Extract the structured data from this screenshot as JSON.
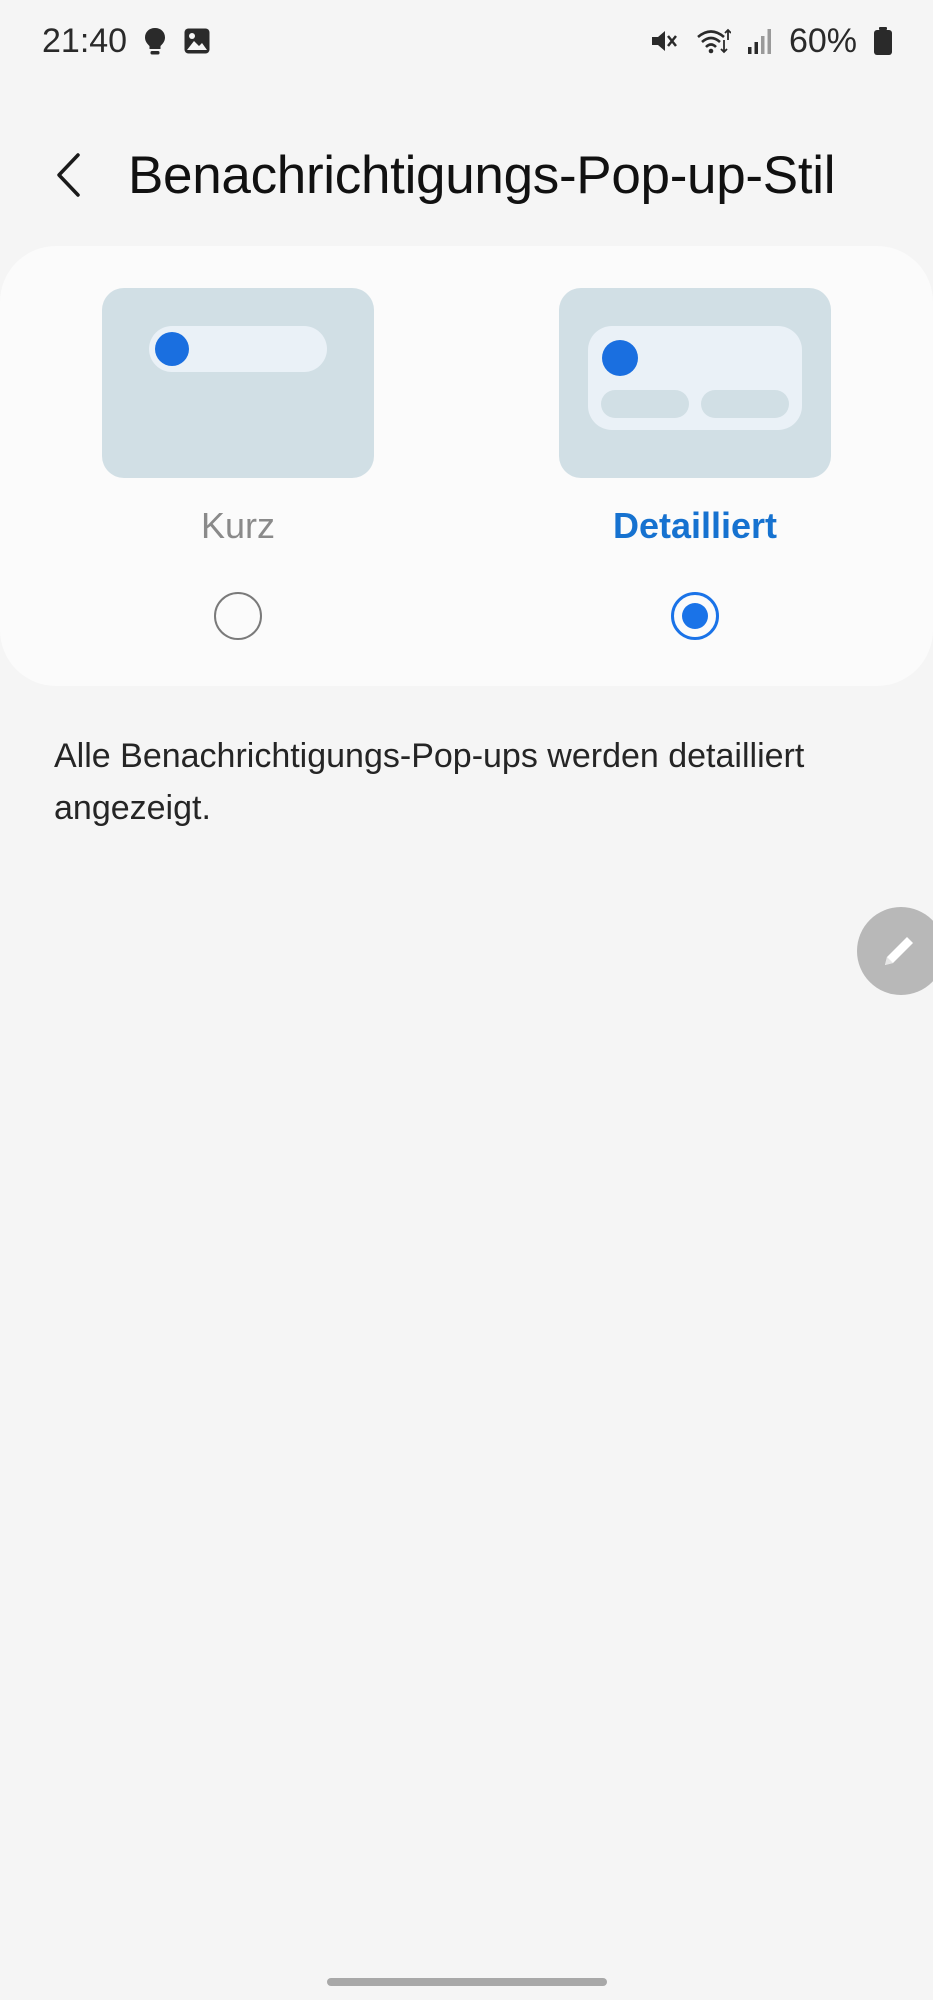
{
  "status_bar": {
    "time": "21:40",
    "battery": "60%",
    "icons": [
      "bulb-icon",
      "image-icon",
      "vibrate-mute-icon",
      "wifi-icon",
      "signal-icon",
      "battery-icon"
    ]
  },
  "header": {
    "back_icon": "chevron-left-icon",
    "title": "Benachrichtigungs-Pop-up-Stil"
  },
  "options": [
    {
      "label": "Kurz",
      "selected": false
    },
    {
      "label": "Detailliert",
      "selected": true
    }
  ],
  "description": "Alle Benachrichtigungs-Pop-ups werden detailliert angezeigt.",
  "floating_button": {
    "icon": "pencil-icon"
  },
  "colors": {
    "accent": "#1a73e8",
    "selected_label": "#1672d0",
    "preview_bg": "#d1dfe5",
    "preview_inner": "#eaf1f7",
    "background": "#f5f5f5",
    "card": "#fbfbfb"
  }
}
